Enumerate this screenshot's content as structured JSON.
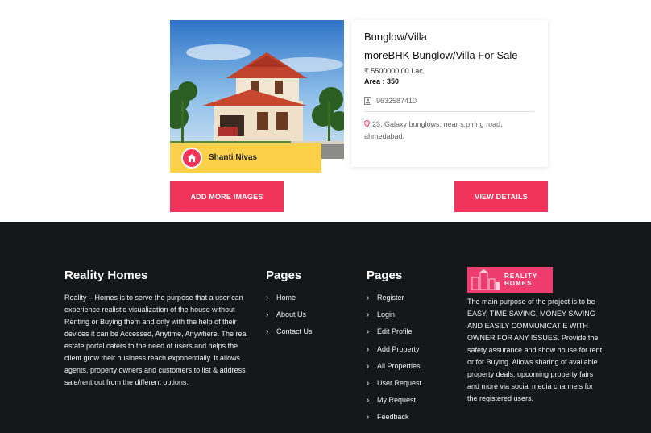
{
  "listing": {
    "title_line1": "Bunglow/Villa",
    "title_line2": "moreBHK Bunglow/Villa For Sale",
    "price": "₹ 5500000.00 Lac",
    "area": "Area : 350",
    "phone": "9632587410",
    "address": "23, Galaxy bunglows, near s.p.ring road, ahmedabad.",
    "owner_name": "Shanti Nivas"
  },
  "actions": {
    "add_images": "ADD MORE IMAGES",
    "view_details": "VIEW DETAILS"
  },
  "footer": {
    "about_title": "Reality Homes",
    "about_text": "Reality – Homes is to serve the purpose that a user can experience realistic visualization of the house without Renting or Buying them and only with the help of their devices it can be Accessed, Anytime, Anywhere. The real estate portal caters to the need of users and helps the client grow their business reach exponentially. It allows agents, property owners and customers to list & address sale/rent out from the different options.",
    "pages1_title": "Pages",
    "pages1_links": [
      "Home",
      "About Us",
      "Contact Us"
    ],
    "pages2_title": "Pages",
    "pages2_links": [
      "Register",
      "Login",
      "Edit Profile",
      "Add Property",
      "All Properties",
      "User Request",
      "My Request",
      "Feedback"
    ],
    "logo_text_line1": "REALITY",
    "logo_text_line2": "HOMES",
    "mission_text": "The main purpose of the project is to be EASY, TIME SAVING, MONEY SAVING AND EASILY COMMUNICAT E WITH OWNER FOR ANY ISSUES. Provide the safety assurance and show house for rent or for Buying. Allows sharing of available property deals, upcoming property fairs and more via social media channels for the registered users."
  },
  "colors": {
    "accent": "#f0345a",
    "owner_bar": "#fcd04a",
    "footer_bg": "#161718"
  }
}
